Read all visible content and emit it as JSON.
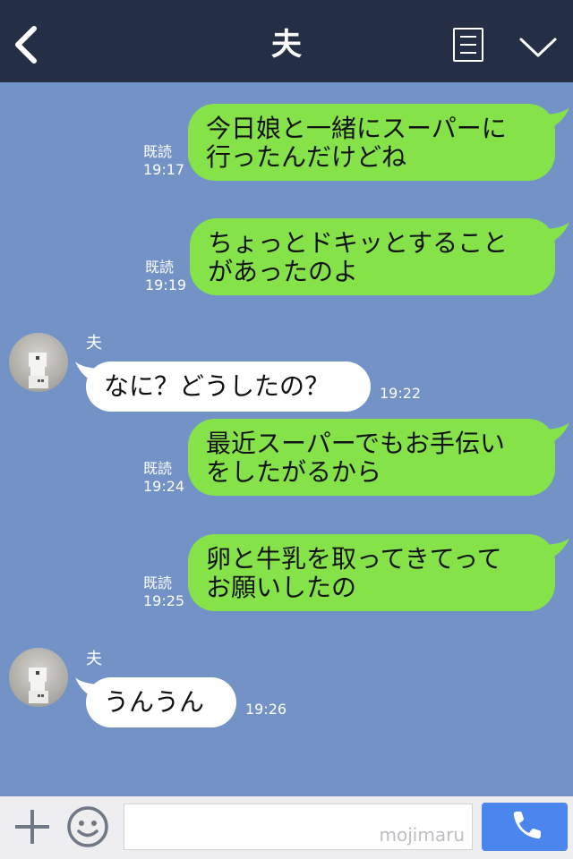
{
  "header": {
    "title": "夫",
    "back_icon": "chevron-left-icon",
    "menu_icon": "notes-icon",
    "collapse_icon": "chevron-down-icon"
  },
  "messages": [
    {
      "direction": "out",
      "lines": [
        "今日娘と一緒にスーパーに",
        "行ったんだけどね"
      ],
      "read": "既読",
      "time": "19:17"
    },
    {
      "direction": "out",
      "lines": [
        "ちょっとドキッとすること",
        "があったのよ"
      ],
      "read": "既読",
      "time": "19:19"
    },
    {
      "direction": "in",
      "sender": "夫",
      "lines": [
        "なに？どうしたの？"
      ],
      "time": "19:22"
    },
    {
      "direction": "out",
      "lines": [
        "最近スーパーでもお手伝い",
        "をしたがるから"
      ],
      "read": "既読",
      "time": "19:24"
    },
    {
      "direction": "out",
      "lines": [
        "卵と牛乳を取ってきてって",
        "お願いしたの"
      ],
      "read": "既読",
      "time": "19:25"
    },
    {
      "direction": "in",
      "sender": "夫",
      "lines": [
        "うんうん"
      ],
      "time": "19:26"
    }
  ],
  "footer": {
    "plus_icon": "plus-icon",
    "emoji_icon": "smiley-icon",
    "input_value": "",
    "watermark": "mojimaru",
    "call_icon": "phone-icon"
  },
  "colors": {
    "header_bg": "#242e45",
    "chat_bg": "#7393c6",
    "outgoing_bubble": "#85e249",
    "incoming_bubble": "#ffffff",
    "call_button": "#4a86ee"
  }
}
